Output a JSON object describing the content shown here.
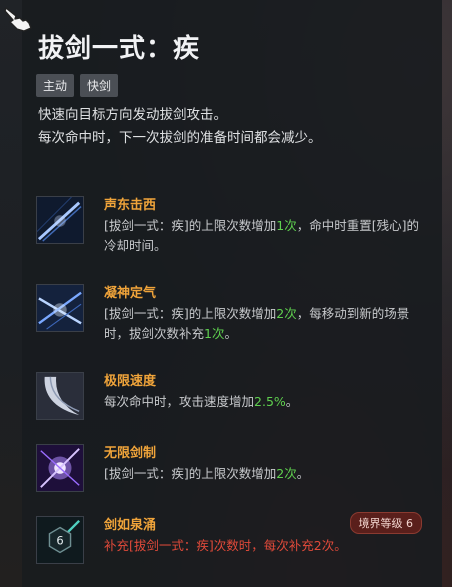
{
  "skill": {
    "title": "拔剑一式：疾",
    "tags": [
      "主动",
      "快剑"
    ],
    "description": [
      "快速向目标方向发动拔剑攻击。",
      "每次命中时，下一次拔剑的准备时间都会减少。"
    ]
  },
  "talents": [
    {
      "name": "声东击西",
      "icon": "sword-slash-icon",
      "text_parts": [
        {
          "t": "[拔剑一式：疾]的上限次数增加",
          "c": ""
        },
        {
          "t": "1次",
          "c": "hl"
        },
        {
          "t": "，命中时重置[残心]的冷却时间。",
          "c": ""
        }
      ]
    },
    {
      "name": "凝神定气",
      "icon": "double-slash-icon",
      "text_parts": [
        {
          "t": "[拔剑一式：疾]的上限次数增加",
          "c": ""
        },
        {
          "t": "2次",
          "c": "hl"
        },
        {
          "t": "，每移动到新的场景时，拔剑次数补充",
          "c": ""
        },
        {
          "t": "1次",
          "c": "hl"
        },
        {
          "t": "。",
          "c": ""
        }
      ]
    },
    {
      "name": "极限速度",
      "icon": "crescent-blade-icon",
      "text_parts": [
        {
          "t": "每次命中时，攻击速度增加",
          "c": ""
        },
        {
          "t": "2.5%",
          "c": "hl"
        },
        {
          "t": "。",
          "c": ""
        }
      ]
    },
    {
      "name": "无限剑制",
      "icon": "purple-burst-icon",
      "text_parts": [
        {
          "t": "[拔剑一式：疾]的上限次数增加",
          "c": ""
        },
        {
          "t": "2次",
          "c": "hl"
        },
        {
          "t": "。",
          "c": ""
        }
      ]
    },
    {
      "name": "剑如泉涌",
      "icon": "hexagon-sword-icon",
      "icon_number": "6",
      "badge": "境界等级 6",
      "text_parts": [
        {
          "t": "补充[拔剑一式：疾]次数时，每次补充2次。",
          "c": "red"
        }
      ]
    }
  ],
  "colors": {
    "accent": "#f0a43a",
    "highlight": "#5fd04f",
    "locked": "#e04a3a"
  }
}
